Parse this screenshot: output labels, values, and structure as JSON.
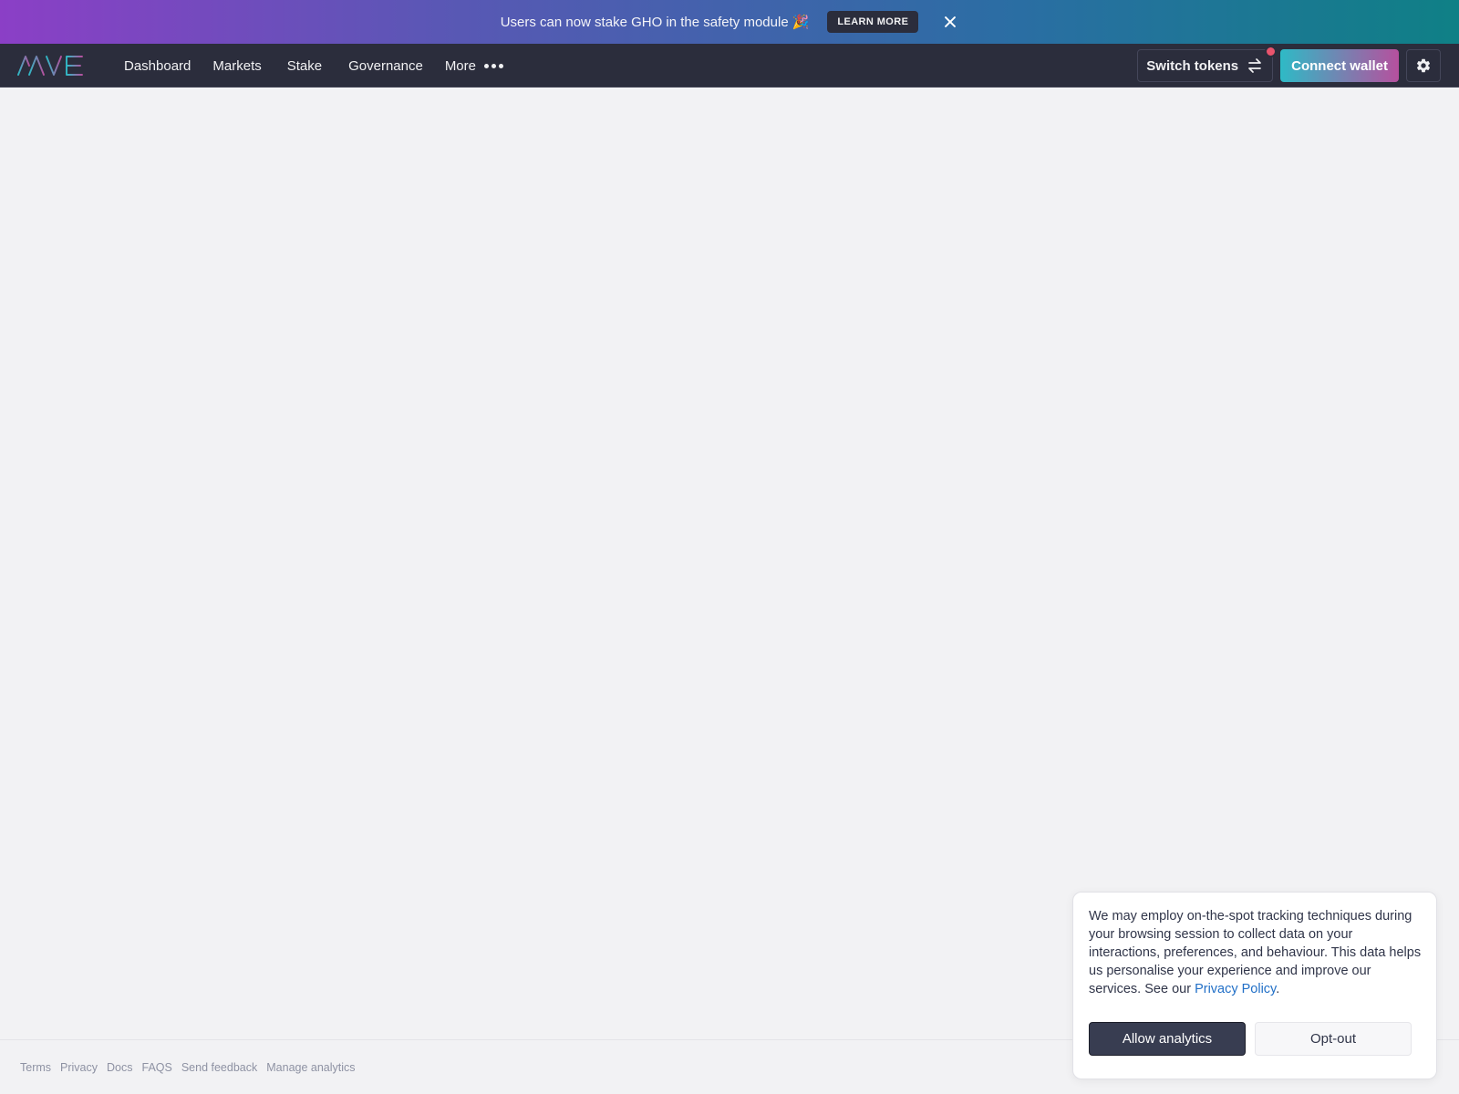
{
  "banner": {
    "message": "Users can now stake GHO in the safety module",
    "emoji": "🎉",
    "learn_more_label": "LEARN MORE",
    "close_icon": "close-icon"
  },
  "navbar": {
    "logo_text": "AAVE",
    "links": [
      "Dashboard",
      "Markets",
      "Stake",
      "Governance",
      "More"
    ],
    "switch_tokens_label": "Switch tokens",
    "connect_wallet_label": "Connect wallet",
    "icons": {
      "more": "more-dots-icon",
      "swap": "swap-arrows-icon",
      "settings": "gear-icon"
    }
  },
  "footer": {
    "links": [
      "Terms",
      "Privacy",
      "Docs",
      "FAQS",
      "Send feedback",
      "Manage analytics"
    ]
  },
  "cookie": {
    "text": "We may employ on-the-spot tracking techniques during your browsing session to collect data on your interactions, preferences, and behaviour. This data helps us personalise your experience and improve our services. See our ",
    "policy_link": "Privacy Policy",
    "text_end": ".",
    "allow_label": "Allow analytics",
    "optout_label": "Opt-out"
  },
  "colors": {
    "banner_gradient_start": "#8b3fc6",
    "banner_gradient_end": "#0f8086",
    "navbar_bg": "#2b2d3c",
    "connect_gradient_start": "#2ebac6",
    "connect_gradient_end": "#b6509e",
    "notification_dot": "#e9546d",
    "link_blue": "#2270c7",
    "page_bg": "#f2f2f4"
  }
}
